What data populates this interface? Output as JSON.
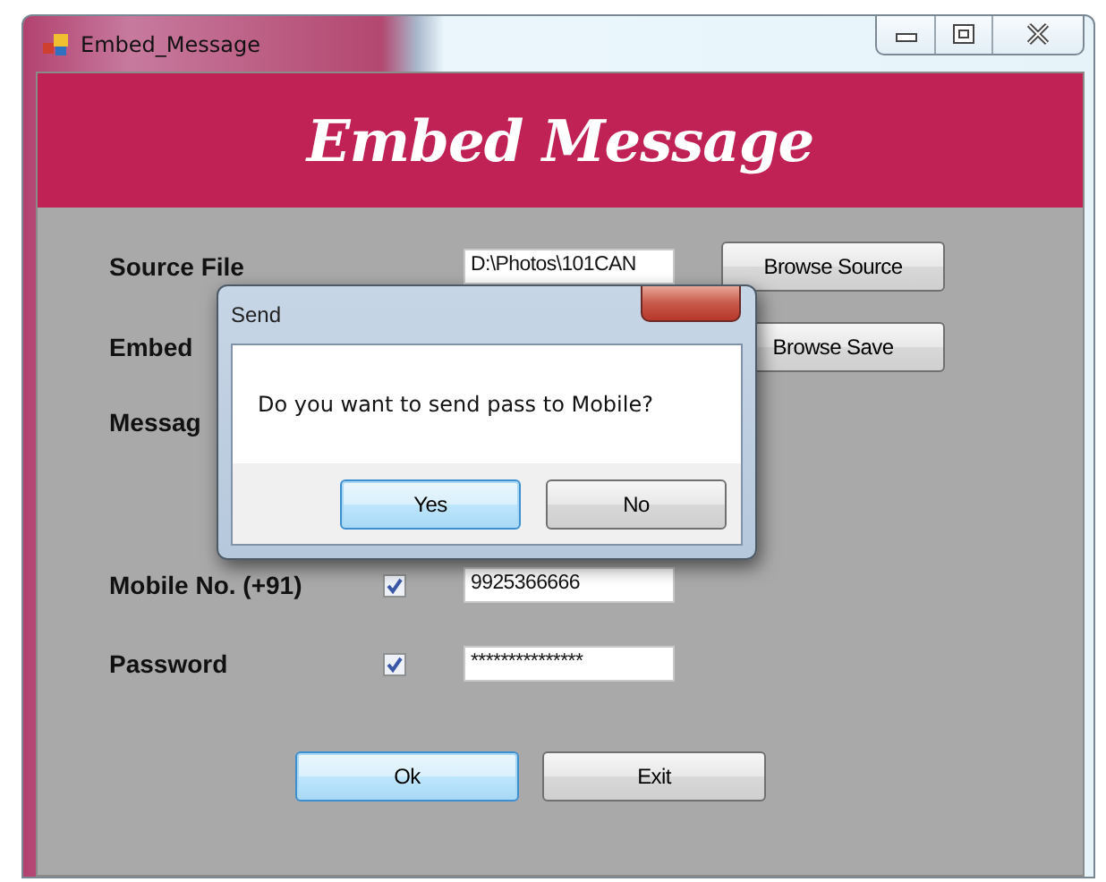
{
  "window": {
    "title": "Embed_Message"
  },
  "banner": "Embed Message",
  "rows": [
    {
      "label": "Source File",
      "value": "D:\\Photos\\101CAN",
      "button": "Browse Source"
    },
    {
      "label": "Embed",
      "button": "Browse Save"
    },
    {
      "label": "Messag"
    },
    {
      "label": "Mobile No. (+91)",
      "checked": true,
      "value": "9925366666"
    },
    {
      "label": "Password",
      "checked": true,
      "value": "***************"
    }
  ],
  "buttons": [
    {
      "label": "Ok",
      "focused": true
    },
    {
      "label": "Exit",
      "focused": false
    }
  ],
  "dialog": {
    "title": "Send",
    "message": "Do you want to send pass to Mobile?",
    "buttons": [
      {
        "label": "Yes",
        "focused": true
      },
      {
        "label": "No",
        "focused": false
      }
    ]
  }
}
